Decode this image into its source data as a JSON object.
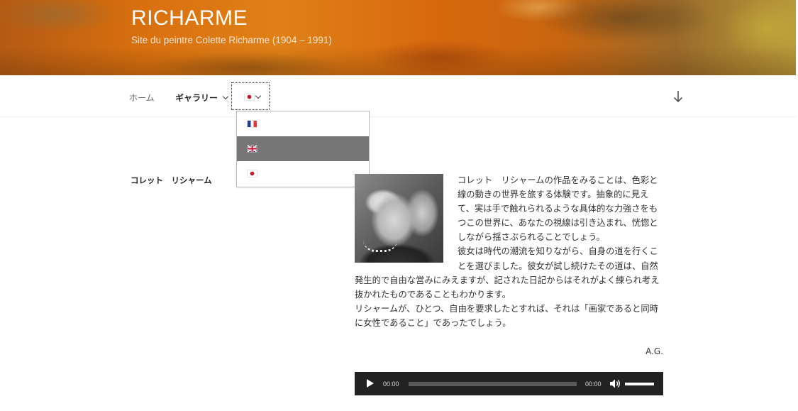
{
  "header": {
    "site_title": "RICHARME",
    "site_description": "Site du peintre Colette Richarme (1904 – 1991)"
  },
  "nav": {
    "home_label": "ホーム",
    "gallery_label": "ギャラリー",
    "current_language_icon": "flag-jp-icon",
    "scroll_icon": "arrow-down-icon"
  },
  "language_dropdown": {
    "items": [
      {
        "icon": "flag-fr-icon",
        "language": "Français",
        "active": false
      },
      {
        "icon": "flag-uk-icon",
        "language": "English",
        "active": true
      },
      {
        "icon": "flag-jp-icon",
        "language": "日本語",
        "active": false
      }
    ],
    "active_color": "#767676"
  },
  "content": {
    "entry_title": "コレット　リシャーム",
    "paragraph_1": "コレット　リシャームの作品をみることは、色彩と線の動きの世界を旅する体験です。抽象的に見えて、実は手で触れられるような具体的な力強さをもつこの世界に、あなたの視線は引き込まれ、恍惚としながら揺さぶられることでしょう。",
    "paragraph_2": "彼女は時代の潮流を知りながら、自身の道を行くことを選びました。彼女が試し続けたその道は、自然発生的で自由な営みにみえますが、記された日記からはそれがよく練られ考え抜かれたものであることもわかります。",
    "paragraph_3": "リシャームが、ひとつ、自由を要求したとすれば、それは「画家であると同時に女性であること」であったでしょう。",
    "signature": "A.G."
  },
  "audio_player": {
    "current_time": "00:00",
    "duration": "00:00",
    "progress": 0,
    "volume": 1.0,
    "background": "#222222"
  }
}
